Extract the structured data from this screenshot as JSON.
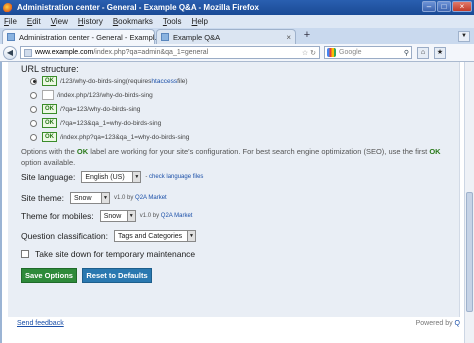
{
  "window": {
    "title": "Administration center - General - Example Q&A - Mozilla Firefox",
    "minimize_label": "–",
    "maximize_label": "□",
    "close_label": "×"
  },
  "menu": [
    "File",
    "Edit",
    "View",
    "History",
    "Bookmarks",
    "Tools",
    "Help"
  ],
  "tabs": [
    {
      "label": "Administration center - General - Exampl...",
      "close": "×"
    },
    {
      "label": "Example Q&A",
      "close": "×"
    }
  ],
  "new_tab": "+",
  "navigation": {
    "back": "◀",
    "url_host": "www.example.com",
    "url_path": "/index.php?qa=admin&qa_1=general",
    "search_placeholder": "Google"
  },
  "page": {
    "url_structure_label": "URL structure:",
    "url_options": [
      {
        "selected": true,
        "ok": true,
        "path": "/123/why-do-birds-sing",
        "note_prefix": " (requires ",
        "note_link": "htaccess",
        "note_suffix": " file)"
      },
      {
        "selected": false,
        "ok": false,
        "path": "/index.php/123/why-do-birds-sing",
        "note_prefix": "",
        "note_link": "",
        "note_suffix": ""
      },
      {
        "selected": false,
        "ok": true,
        "path": "/?qa=123/why-do-birds-sing",
        "note_prefix": "",
        "note_link": "",
        "note_suffix": ""
      },
      {
        "selected": false,
        "ok": true,
        "path": "/?qa=123&qa_1=why-do-birds-sing",
        "note_prefix": "",
        "note_link": "",
        "note_suffix": ""
      },
      {
        "selected": false,
        "ok": true,
        "path": "/index.php?qa=123&qa_1=why-do-birds-sing",
        "note_prefix": "",
        "note_link": "",
        "note_suffix": ""
      }
    ],
    "ok_label": "OK",
    "note_before": "Options with the",
    "note_ok": "OK",
    "note_middle": "label are working for your site's configuration. For best search engine optimization (SEO), use the first",
    "note_end_ok": "OK",
    "note_after": "option available.",
    "site_language": {
      "label": "Site language:",
      "value": "English (US)",
      "hint_link": "check language files"
    },
    "site_theme": {
      "label": "Site theme:",
      "value": "Snow",
      "hint_version": "v1.0 by",
      "hint_link": "Q2A Market"
    },
    "mobile_theme": {
      "label": "Theme for mobiles:",
      "value": "Snow",
      "hint_version": "v1.0 by",
      "hint_link": "Q2A Market"
    },
    "question_classification": {
      "label": "Question classification:",
      "value": "Tags and Categories"
    },
    "take_site_down": {
      "label": "Take site down for temporary maintenance",
      "checked": false
    },
    "save_button": "Save Options",
    "reset_button": "Reset to Defaults",
    "footer_link": "Send feedback",
    "powered_by": "Powered by",
    "powered_link": "Q"
  }
}
